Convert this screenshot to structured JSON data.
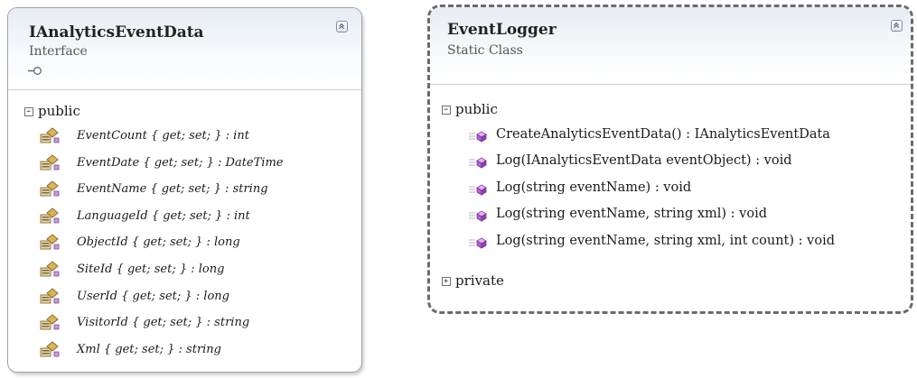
{
  "interface_shape": {
    "name": "IAnalyticsEventData",
    "stereotype": "Interface",
    "section": "public",
    "properties": [
      "EventCount { get; set; } : int",
      "EventDate { get; set; } : DateTime",
      "EventName { get; set; } : string",
      "LanguageId { get; set; } : int",
      "ObjectId { get; set; } : long",
      "SiteId { get; set; } : long",
      "UserId { get; set; } : long",
      "VisitorId { get; set; } : string",
      "Xml { get; set; } : string"
    ],
    "property_icon": "property-icon",
    "lollipop_icon": "interface-lollipop-icon"
  },
  "class_shape": {
    "name": "EventLogger",
    "stereotype": "Static Class",
    "public_section": "public",
    "private_section": "private",
    "methods": [
      "CreateAnalyticsEventData() : IAnalyticsEventData",
      "Log(IAnalyticsEventData eventObject) : void",
      "Log(string eventName) : void",
      "Log(string eventName, string xml) : void",
      "Log(string eventName, string xml, int count) : void"
    ],
    "method_icon": "method-icon"
  },
  "colors": {
    "header_gradient_top": "#e7ecf3",
    "method_icon": "#b65fd0",
    "property_icon": "#d9b45a",
    "class_border": "#6b6b6b"
  }
}
